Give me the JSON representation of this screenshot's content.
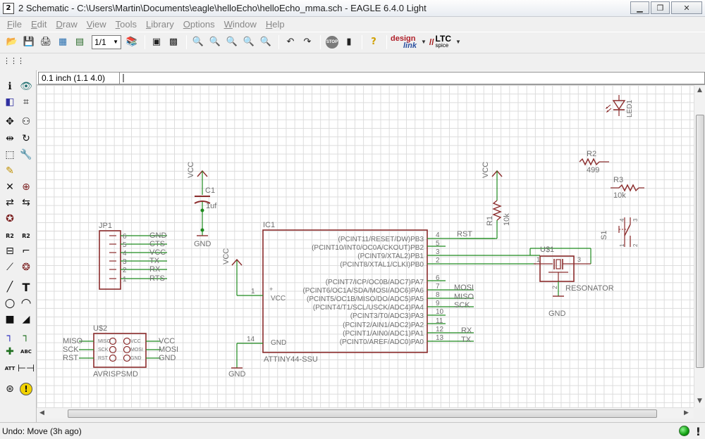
{
  "window": {
    "title": "2 Schematic - C:\\Users\\Martin\\Documents\\eagle\\helloEcho\\helloEcho_mma.sch - EAGLE 6.4.0 Light",
    "icon_label": "2"
  },
  "menu": [
    "File",
    "Edit",
    "Draw",
    "View",
    "Tools",
    "Library",
    "Options",
    "Window",
    "Help"
  ],
  "toolbar": {
    "sheet_value": "1/1",
    "designlink_top": "design",
    "designlink_bottom": "link",
    "ltc_top": "LTC",
    "ltc_bottom": "spice",
    "stop_label": "STOP"
  },
  "coordinate": "0.1 inch (1.1 4.0)",
  "status": "Undo: Move (3h ago)",
  "colors": {
    "wire": "#1f8a1f",
    "symbol": "#8b2c2c",
    "text": "#707070",
    "pin": "#7a1f1f",
    "grid": "#dcdcdc"
  },
  "schematic": {
    "jp1": {
      "name": "JP1",
      "pins": [
        "6",
        "5",
        "4",
        "3",
        "2",
        "1"
      ],
      "nets": [
        "GND",
        "CTS",
        "VCC",
        "TX",
        "RX",
        "RTS"
      ]
    },
    "c1": {
      "name": "C1",
      "value": "1uf",
      "vcc": "VCC",
      "gnd": "GND"
    },
    "ic1": {
      "name": "IC1",
      "value": "ATTINY44-SSU",
      "pins_right": [
        {
          "label": "(PCINT11/RESET/DW)PB3",
          "num": "4",
          "net": "RST"
        },
        {
          "label": "(PCINT10/INT0/OC0A/CKOUT)PB2",
          "num": "5",
          "net": ""
        },
        {
          "label": "(PCINT9/XTAL2)PB1",
          "num": "3",
          "net": ""
        },
        {
          "label": "(PCINT8/XTAL1/CLKI)PB0",
          "num": "2",
          "net": ""
        },
        {
          "label": "(PCINT7/ICP/OC0B/ADC7)PA7",
          "num": "6",
          "net": ""
        },
        {
          "label": "(PCINT6/OC1A/SDA/MOSI/ADC6)PA6",
          "num": "7",
          "net": "MOSI"
        },
        {
          "label": "(PCINT5/OC1B/MISO/DO/ADC5)PA5",
          "num": "8",
          "net": "MISO"
        },
        {
          "label": "(PCINT4/T1/SCL/USCK/ADC4)PA4",
          "num": "9",
          "net": "SCK"
        },
        {
          "label": "(PCINT3/T0/ADC3)PA3",
          "num": "10",
          "net": ""
        },
        {
          "label": "(PCINT2/AIN1/ADC2)PA2",
          "num": "11",
          "net": ""
        },
        {
          "label": "(PCINT1/AIN0/ADC1)PA1",
          "num": "12",
          "net": "RX"
        },
        {
          "label": "(PCINT0/AREF/ADC0)PA0",
          "num": "13",
          "net": "TX"
        }
      ],
      "vcc_pin": {
        "num": "1",
        "label": "VCC"
      },
      "gnd_pin": {
        "num": "14",
        "label": "GND"
      },
      "vcc_net": "VCC",
      "gnd_net": "GND"
    },
    "r1": {
      "name": "R1",
      "value": "10k",
      "vcc": "VCC"
    },
    "u1": {
      "name": "U$1",
      "value": "RESONATOR",
      "pin1": "1",
      "pin2": "2",
      "pin3": "3",
      "gnd": "GND"
    },
    "u2": {
      "name": "U$2",
      "value": "AVRISPSMD",
      "left_nets": [
        "MISO",
        "SCK",
        "RST"
      ],
      "right_nets": [
        "VCC",
        "MOSI",
        "GND"
      ],
      "inner_left": [
        "MISO",
        "SCK",
        "RST"
      ],
      "inner_right": [
        "VCC",
        "MOSI",
        "GND"
      ]
    },
    "led1": {
      "name": "LED1"
    },
    "r2": {
      "name": "R2",
      "value": "499"
    },
    "r3": {
      "name": "R3",
      "value": "10k"
    },
    "s1": {
      "name": "S1",
      "pins": [
        "4",
        "3",
        "1",
        "2"
      ]
    }
  }
}
